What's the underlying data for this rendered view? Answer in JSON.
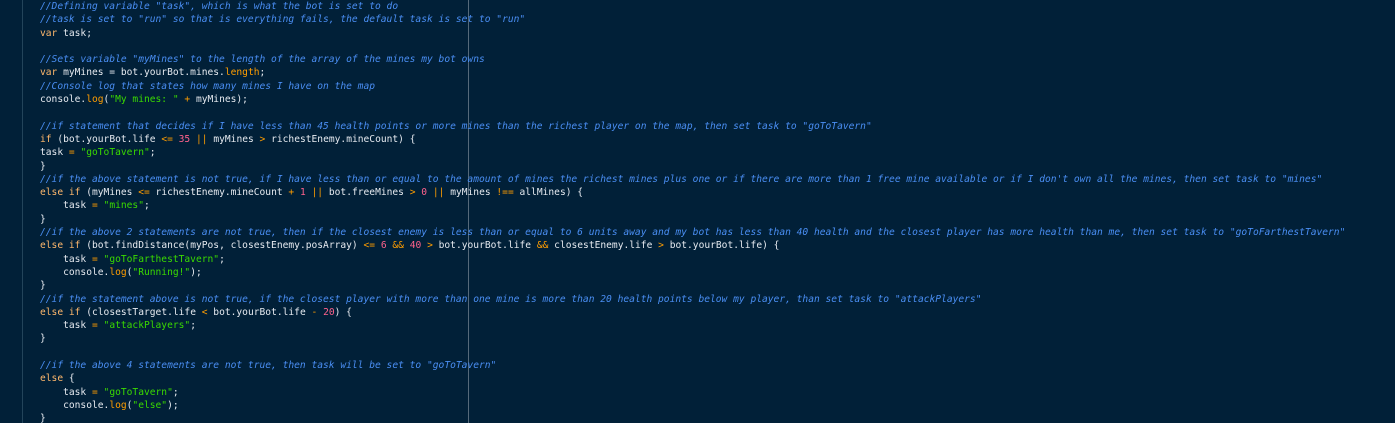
{
  "editor": {
    "colors": {
      "background": "#012038",
      "comment": "#4a8ef3",
      "keyword": "#ffb86c",
      "string": "#3ad900",
      "number": "#ff628c",
      "property": "#ff9d00",
      "plain": "#e6eaf0"
    },
    "lines": [
      [
        [
          "comment",
          "//Defining variable \"task\", which is what the bot is set to do"
        ]
      ],
      [
        [
          "comment",
          "//task is set to \"run\" so that is everything fails, the default task is set to \"run\""
        ]
      ],
      [
        [
          "keyword",
          "var"
        ],
        [
          "plain",
          " task;"
        ]
      ],
      [],
      [
        [
          "comment",
          "//Sets variable \"myMines\" to the length of the array of the mines my bot owns"
        ]
      ],
      [
        [
          "keyword",
          "var"
        ],
        [
          "plain",
          " myMines = bot.yourBot.mines."
        ],
        [
          "prop",
          "length"
        ],
        [
          "plain",
          ";"
        ]
      ],
      [
        [
          "comment",
          "//Console log that states how many mines I have on the map"
        ]
      ],
      [
        [
          "plain",
          "console."
        ],
        [
          "prop",
          "log"
        ],
        [
          "plain",
          "("
        ],
        [
          "string",
          "\"My mines: \""
        ],
        [
          "plain",
          " "
        ],
        [
          "op",
          "+"
        ],
        [
          "plain",
          " myMines);"
        ]
      ],
      [],
      [
        [
          "comment",
          "//if statement that decides if I have less than 45 health points or more mines than the richest player on the map, then set task to \"goToTavern\""
        ]
      ],
      [
        [
          "keyword",
          "if"
        ],
        [
          "plain",
          " (bot.yourBot.life "
        ],
        [
          "op",
          "<="
        ],
        [
          "plain",
          " "
        ],
        [
          "number",
          "35"
        ],
        [
          "plain",
          " "
        ],
        [
          "op",
          "||"
        ],
        [
          "plain",
          " myMines "
        ],
        [
          "op",
          ">"
        ],
        [
          "plain",
          " richestEnemy.mineCount) {"
        ]
      ],
      [
        [
          "plain",
          "task "
        ],
        [
          "op",
          "="
        ],
        [
          "plain",
          " "
        ],
        [
          "string",
          "\"goToTavern\""
        ],
        [
          "plain",
          ";"
        ]
      ],
      [
        [
          "plain",
          "}"
        ]
      ],
      [
        [
          "comment",
          "//if the above statement is not true, if I have less than or equal to the amount of mines the richest mines plus one or if there are more than 1 free mine available or if I don't own all the mines, then set task to \"mines\""
        ]
      ],
      [
        [
          "keyword",
          "else"
        ],
        [
          "plain",
          " "
        ],
        [
          "keyword",
          "if"
        ],
        [
          "plain",
          " (myMines "
        ],
        [
          "op",
          "<="
        ],
        [
          "plain",
          " richestEnemy.mineCount "
        ],
        [
          "op",
          "+"
        ],
        [
          "plain",
          " "
        ],
        [
          "number",
          "1"
        ],
        [
          "plain",
          " "
        ],
        [
          "op",
          "||"
        ],
        [
          "plain",
          " bot.freeMines "
        ],
        [
          "op",
          ">"
        ],
        [
          "plain",
          " "
        ],
        [
          "number",
          "0"
        ],
        [
          "plain",
          " "
        ],
        [
          "op",
          "||"
        ],
        [
          "plain",
          " myMines "
        ],
        [
          "op",
          "!=="
        ],
        [
          "plain",
          " allMines) {"
        ]
      ],
      [
        [
          "plain",
          "    task "
        ],
        [
          "op",
          "="
        ],
        [
          "plain",
          " "
        ],
        [
          "string",
          "\"mines\""
        ],
        [
          "plain",
          ";"
        ]
      ],
      [
        [
          "plain",
          "}"
        ]
      ],
      [
        [
          "comment",
          "//if the above 2 statements are not true, then if the closest enemy is less than or equal to 6 units away and my bot has less than 40 health and the closest player has more health than me, then set task to \"goToFarthestTavern\""
        ]
      ],
      [
        [
          "keyword",
          "else"
        ],
        [
          "plain",
          " "
        ],
        [
          "keyword",
          "if"
        ],
        [
          "plain",
          " (bot.findDistance(myPos, closestEnemy.posArray) "
        ],
        [
          "op",
          "<="
        ],
        [
          "plain",
          " "
        ],
        [
          "number",
          "6"
        ],
        [
          "plain",
          " "
        ],
        [
          "op",
          "&&"
        ],
        [
          "plain",
          " "
        ],
        [
          "number",
          "40"
        ],
        [
          "plain",
          " "
        ],
        [
          "op",
          ">"
        ],
        [
          "plain",
          " bot.yourBot.life "
        ],
        [
          "op",
          "&&"
        ],
        [
          "plain",
          " closestEnemy.life "
        ],
        [
          "op",
          ">"
        ],
        [
          "plain",
          " bot.yourBot.life) {"
        ]
      ],
      [
        [
          "plain",
          "    task "
        ],
        [
          "op",
          "="
        ],
        [
          "plain",
          " "
        ],
        [
          "string",
          "\"goToFarthestTavern\""
        ],
        [
          "plain",
          ";"
        ]
      ],
      [
        [
          "plain",
          "    console."
        ],
        [
          "prop",
          "log"
        ],
        [
          "plain",
          "("
        ],
        [
          "string",
          "\"Running!\""
        ],
        [
          "plain",
          ");"
        ]
      ],
      [
        [
          "plain",
          "}"
        ]
      ],
      [
        [
          "comment",
          "//if the statement above is not true, if the closest player with more than one mine is more than 20 health points below my player, than set task to \"attackPlayers\""
        ]
      ],
      [
        [
          "keyword",
          "else"
        ],
        [
          "plain",
          " "
        ],
        [
          "keyword",
          "if"
        ],
        [
          "plain",
          " (closestTarget.life "
        ],
        [
          "op",
          "<"
        ],
        [
          "plain",
          " bot.yourBot.life "
        ],
        [
          "op",
          "-"
        ],
        [
          "plain",
          " "
        ],
        [
          "number",
          "20"
        ],
        [
          "plain",
          ") {"
        ]
      ],
      [
        [
          "plain",
          "    task "
        ],
        [
          "op",
          "="
        ],
        [
          "plain",
          " "
        ],
        [
          "string",
          "\"attackPlayers\""
        ],
        [
          "plain",
          ";"
        ]
      ],
      [
        [
          "plain",
          "}"
        ]
      ],
      [],
      [
        [
          "comment",
          "//if the above 4 statements are not true, then task will be set to \"goToTavern\""
        ]
      ],
      [
        [
          "keyword",
          "else"
        ],
        [
          "plain",
          " {"
        ]
      ],
      [
        [
          "plain",
          "    task "
        ],
        [
          "op",
          "="
        ],
        [
          "plain",
          " "
        ],
        [
          "string",
          "\"goToTavern\""
        ],
        [
          "plain",
          ";"
        ]
      ],
      [
        [
          "plain",
          "    console."
        ],
        [
          "prop",
          "log"
        ],
        [
          "plain",
          "("
        ],
        [
          "string",
          "\"else\""
        ],
        [
          "plain",
          ");"
        ]
      ],
      [
        [
          "plain",
          "}"
        ]
      ]
    ]
  }
}
